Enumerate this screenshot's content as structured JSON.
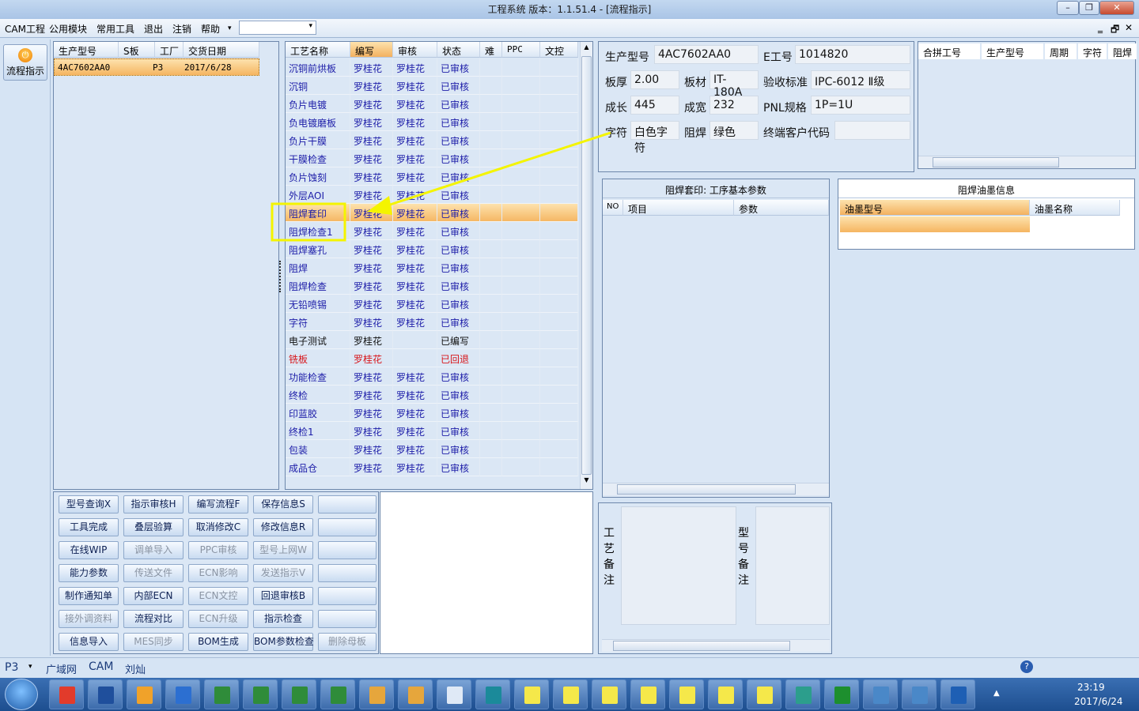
{
  "window": {
    "title": "工程系统   版本：1.1.51.4 - [流程指示]",
    "minimize": "–",
    "restore": "❐",
    "close": "✕",
    "inner_min": "‗",
    "inner_restore": "🗗",
    "inner_close": "✕"
  },
  "menu": [
    "CAM工程",
    "公用模块",
    "常用工具",
    "退出",
    "注销",
    "帮助"
  ],
  "sidebar": {
    "flow_button": "流程指示"
  },
  "jobs": {
    "headers": [
      "生产型号",
      "S板",
      "工厂",
      "交货日期"
    ],
    "rows": [
      [
        "4AC7602AA0",
        "",
        "P3",
        "2017/6/28"
      ]
    ]
  },
  "process": {
    "headers": [
      "工艺名称",
      "编写",
      "审核",
      "状态",
      "难",
      "PPC",
      "文控"
    ],
    "rows": [
      [
        "沉铜前烘板",
        "罗桂花",
        "罗桂花",
        "已审核",
        "blue"
      ],
      [
        "沉铜",
        "罗桂花",
        "罗桂花",
        "已审核",
        "blue"
      ],
      [
        "负片电镀",
        "罗桂花",
        "罗桂花",
        "已审核",
        "blue"
      ],
      [
        "负电镀磨板",
        "罗桂花",
        "罗桂花",
        "已审核",
        "blue"
      ],
      [
        "负片干膜",
        "罗桂花",
        "罗桂花",
        "已审核",
        "blue"
      ],
      [
        "干膜检查",
        "罗桂花",
        "罗桂花",
        "已审核",
        "blue"
      ],
      [
        "负片蚀刻",
        "罗桂花",
        "罗桂花",
        "已审核",
        "blue"
      ],
      [
        "外层AOI",
        "罗桂花",
        "罗桂花",
        "已审核",
        "blue"
      ],
      [
        "阻焊套印",
        "罗桂花",
        "罗桂花",
        "已审核",
        "blue"
      ],
      [
        "阻焊检查1",
        "罗桂花",
        "罗桂花",
        "已审核",
        "blue"
      ],
      [
        "阻焊塞孔",
        "罗桂花",
        "罗桂花",
        "已审核",
        "blue"
      ],
      [
        "阻焊",
        "罗桂花",
        "罗桂花",
        "已审核",
        "blue"
      ],
      [
        "阻焊检查",
        "罗桂花",
        "罗桂花",
        "已审核",
        "blue"
      ],
      [
        "无铅喷锡",
        "罗桂花",
        "罗桂花",
        "已审核",
        "blue"
      ],
      [
        "字符",
        "罗桂花",
        "罗桂花",
        "已审核",
        "blue"
      ],
      [
        "电子测试",
        "罗桂花",
        "",
        "已编写",
        "blk"
      ],
      [
        "铣板",
        "罗桂花",
        "",
        "已回退",
        "red"
      ],
      [
        "功能检查",
        "罗桂花",
        "罗桂花",
        "已审核",
        "blue"
      ],
      [
        "终检",
        "罗桂花",
        "罗桂花",
        "已审核",
        "blue"
      ],
      [
        "印蓝胶",
        "罗桂花",
        "罗桂花",
        "已审核",
        "blue"
      ],
      [
        "终检1",
        "罗桂花",
        "罗桂花",
        "已审核",
        "blue"
      ],
      [
        "包装",
        "罗桂花",
        "罗桂花",
        "已审核",
        "blue"
      ],
      [
        "成品仓",
        "罗桂花",
        "罗桂花",
        "已审核",
        "blue"
      ]
    ],
    "selected_index": 8
  },
  "info": {
    "生产型号": {
      "label": "生产型号",
      "value": "4AC7602AA0"
    },
    "E工号": {
      "label": "E工号",
      "value": "1014820"
    },
    "板厚": {
      "label": "板厚",
      "value": "2.00"
    },
    "板材": {
      "label": "板材",
      "value": "IT-180A"
    },
    "验收标准": {
      "label": "验收标准",
      "value": "IPC-6012 Ⅱ级"
    },
    "成长": {
      "label": "成长",
      "value": "445"
    },
    "成宽": {
      "label": "成宽",
      "value": "232"
    },
    "PNL规格": {
      "label": "PNL规格",
      "value": "1P=1U"
    },
    "字符": {
      "label": "字符",
      "value": "白色字符"
    },
    "阻焊": {
      "label": "阻焊",
      "value": "绿色"
    },
    "终端客户代码": {
      "label": "终端客户代码",
      "value": ""
    }
  },
  "merge": {
    "headers": [
      "合拼工号",
      "生产型号",
      "周期",
      "字符",
      "阻焊"
    ]
  },
  "params": {
    "title": "阻焊套印: 工序基本参数",
    "headers": [
      "NO",
      "项目",
      "参数"
    ]
  },
  "ink": {
    "title": "阻焊油墨信息",
    "headers": [
      "油墨型号",
      "油墨名称"
    ]
  },
  "notes": {
    "process_note": "工艺备注",
    "model_note": "型号备注"
  },
  "buttons": [
    [
      "型号查询X",
      "指示审核H",
      "编写流程F",
      "保存信息S",
      ""
    ],
    [
      "工具完成",
      "叠层验算",
      "取消修改C",
      "修改信息R",
      ""
    ],
    [
      "在线WIP",
      "调单导入",
      "PPC审核",
      "型号上网W",
      ""
    ],
    [
      "能力参数",
      "传送文件",
      "ECN影响",
      "发送指示V",
      ""
    ],
    [
      "制作通知单",
      "内部ECN",
      "ECN文控",
      "回退审核B",
      ""
    ],
    [
      "接外调资料",
      "流程对比",
      "ECN升级",
      "指示检查",
      ""
    ],
    [
      "信息导入",
      "MES同步",
      "BOM生成",
      "BOM参数检查",
      "删除母板"
    ]
  ],
  "disabled_buttons": [
    "调单导入",
    "PPC审核",
    "型号上网W",
    "传送文件",
    "ECN影响",
    "发送指示V",
    "ECN文控",
    "接外调资料",
    "ECN升级",
    "MES同步",
    "删除母板"
  ],
  "status": {
    "factory": "P3",
    "tabs": [
      "广域网",
      "CAM",
      "刘灿"
    ]
  },
  "taskbar": {
    "time": "23:19",
    "date": "2017/6/24"
  },
  "colors": {
    "selected_row": "#f5b561",
    "blue_text": "#1c1ca8",
    "red_text": "#d8161b",
    "arrow": "#f4f400"
  }
}
